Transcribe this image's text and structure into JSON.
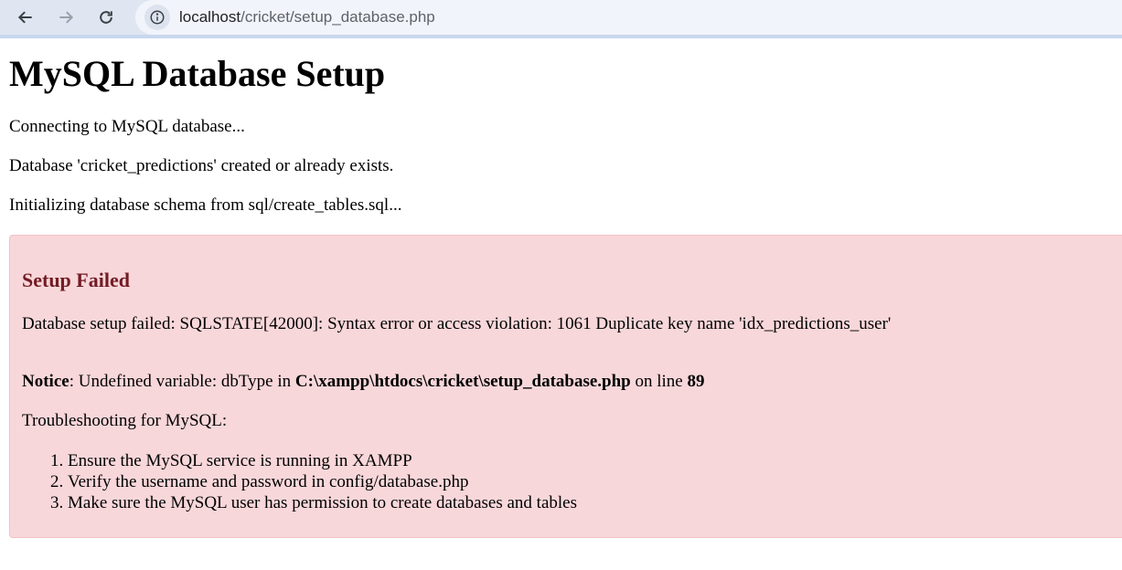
{
  "browser": {
    "url_host": "localhost",
    "url_path": "/cricket/setup_database.php"
  },
  "page": {
    "title": "MySQL Database Setup",
    "messages": [
      "Connecting to MySQL database...",
      "Database 'cricket_predictions' created or already exists.",
      "Initializing database schema from sql/create_tables.sql..."
    ]
  },
  "error": {
    "title": "Setup Failed",
    "message": "Database setup failed: SQLSTATE[42000]: Syntax error or access violation: 1061 Duplicate key name 'idx_predictions_user'",
    "notice_label": "Notice",
    "notice_text": ": Undefined variable: dbType in ",
    "notice_file": "C:\\xampp\\htdocs\\cricket\\setup_database.php",
    "notice_on_line": " on line ",
    "notice_line": "89",
    "troubleshooting_heading": "Troubleshooting for MySQL:",
    "steps": [
      "Ensure the MySQL service is running in XAMPP",
      "Verify the username and password in config/database.php",
      "Make sure the MySQL user has permission to create databases and tables"
    ]
  }
}
